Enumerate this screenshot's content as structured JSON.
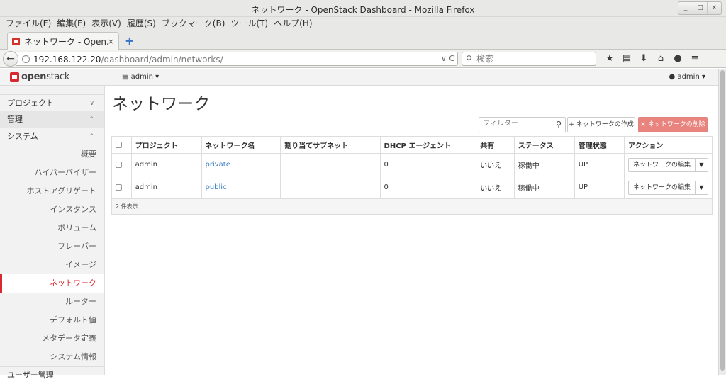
{
  "window": {
    "title": "ネットワーク - OpenStack Dashboard - Mozilla Firefox",
    "min": "_",
    "max": "□",
    "close": "×"
  },
  "menu": [
    "ファイル(F)",
    "編集(E)",
    "表示(V)",
    "履歴(S)",
    "ブックマーク(B)",
    "ツール(T)",
    "ヘルプ(H)"
  ],
  "tab": {
    "label": "ネットワーク - Open...",
    "close": "×",
    "new": "+"
  },
  "nav": {
    "url_host": "192.168.122.20",
    "url_path": "/dashboard/admin/networks/",
    "url_icons": "∨ C",
    "search_placeholder": "検索",
    "toolbar_icons": [
      "★",
      "▤",
      "⬇",
      "⌂",
      "●",
      "≡"
    ]
  },
  "header": {
    "logo_open": "open",
    "logo_stack": "stack",
    "project": "admin",
    "user": "admin"
  },
  "sidebar": {
    "sections": [
      {
        "label": "プロジェクト",
        "chev": "∨"
      },
      {
        "label": "管理",
        "chev": "^"
      },
      {
        "label": "システム",
        "chev": "^"
      }
    ],
    "items": [
      "概要",
      "ハイパーバイザー",
      "ホストアグリゲート",
      "インスタンス",
      "ボリューム",
      "フレーバー",
      "イメージ",
      "ネットワーク",
      "ルーター",
      "デフォルト値",
      "メタデータ定義",
      "システム情報"
    ],
    "active_index": 7,
    "footer_section": "ユーザー管理"
  },
  "main": {
    "title": "ネットワーク",
    "filter_placeholder": "フィルター",
    "create_label": "+ ネットワークの作成",
    "delete_label": "× ネットワークの削除",
    "columns": [
      "プロジェクト",
      "ネットワーク名",
      "割り当てサブネット",
      "DHCP エージェント",
      "共有",
      "ステータス",
      "管理状態",
      "アクション"
    ],
    "rows": [
      {
        "project": "admin",
        "name": "private",
        "subnets": "",
        "dhcp": "0",
        "shared": "いいえ",
        "status": "稼働中",
        "admin_state": "UP",
        "action": "ネットワークの編集"
      },
      {
        "project": "admin",
        "name": "public",
        "subnets": "",
        "dhcp": "0",
        "shared": "いいえ",
        "status": "稼働中",
        "admin_state": "UP",
        "action": "ネットワークの編集"
      }
    ],
    "footer": "2 件表示"
  },
  "colors": {
    "accent": "#d7292f",
    "link": "#3a7fc1",
    "danger_btn": "#e8837e"
  }
}
